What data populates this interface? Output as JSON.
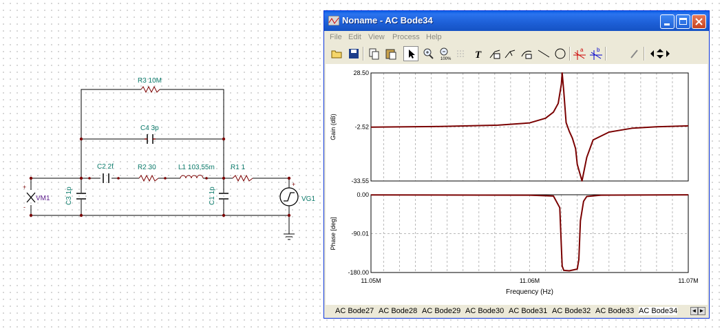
{
  "schematic": {
    "labels": {
      "r3": "R3 10M",
      "c4": "C4 3p",
      "c2": "C2 2f",
      "r2": "R2 30",
      "l1": "L1 103,55m",
      "r1": "R1 1",
      "c3": "C3 1p",
      "c1": "C1 1p",
      "vm1": "VM1",
      "vg1": "VG1",
      "plus": "+",
      "minus": "-"
    }
  },
  "window": {
    "title": "Noname - AC Bode34",
    "menu": [
      "File",
      "Edit",
      "View",
      "Process",
      "Help"
    ],
    "toolbar_icons": [
      "open-icon",
      "save-icon",
      "copy-icon",
      "paste-icon",
      "select-arrow-icon",
      "zoom-in-icon",
      "zoom-100-icon",
      "grid-icon",
      "text-icon",
      "annotate-icon",
      "annotate-2-icon",
      "annotate-3-icon",
      "line-icon",
      "circle-icon",
      "cursor-a-icon",
      "cursor-b-icon",
      "eyedropper-icon",
      "nav-arrows-icon"
    ],
    "tabs": [
      "AC Bode27",
      "AC Bode28",
      "AC Bode29",
      "AC Bode30",
      "AC Bode31",
      "AC Bode32",
      "AC Bode33",
      "AC Bode34"
    ],
    "active_tab": "AC Bode34"
  },
  "chart_data": [
    {
      "type": "line",
      "ylabel": "Gain (dB)",
      "ylim": [
        -33.55,
        28.5
      ],
      "yticks": [
        "28.50",
        "-2.52",
        "-33.55"
      ],
      "xlim": [
        11050000,
        11070000
      ],
      "grid": true,
      "series": [
        {
          "color": "#7a0000",
          "x": [
            11050000,
            11054000,
            11058000,
            11060000,
            11061000,
            11061500,
            11061800,
            11062000,
            11062050,
            11062150,
            11062300,
            11062500,
            11062700,
            11062900,
            11063000,
            11063300,
            11063600,
            11064000,
            11065000,
            11066500,
            11068000,
            11070000
          ],
          "y": [
            -2.6,
            -2.3,
            -1.5,
            -0.2,
            2.5,
            6.0,
            11.0,
            22.0,
            28.5,
            18.0,
            0.0,
            -5.0,
            -9.0,
            -15.0,
            -24.0,
            -33.5,
            -20.0,
            -10.0,
            -5.5,
            -3.2,
            -2.4,
            -1.9
          ]
        }
      ]
    },
    {
      "type": "line",
      "ylabel": "Phase [deg]",
      "ylim": [
        -180.0,
        0.0
      ],
      "yticks": [
        "0.00",
        "-90.01",
        "-180.00"
      ],
      "xlim": [
        11050000,
        11070000
      ],
      "xticks": [
        "11.05M",
        "11.06M",
        "11.07M"
      ],
      "xlabel": "Frequency (Hz)",
      "grid": true,
      "series": [
        {
          "color": "#7a0000",
          "x": [
            11050000,
            11060000,
            11061500,
            11061900,
            11062000,
            11062050,
            11062150,
            11062500,
            11063000,
            11063100,
            11063200,
            11063400,
            11063600,
            11064500,
            11070000
          ],
          "y": [
            -0.3,
            -1.0,
            -3.0,
            -30.0,
            -120.0,
            -165.0,
            -175.0,
            -176.0,
            -172.0,
            -150.0,
            -60.0,
            -15.0,
            -4.0,
            -1.0,
            -0.2
          ]
        }
      ]
    }
  ]
}
